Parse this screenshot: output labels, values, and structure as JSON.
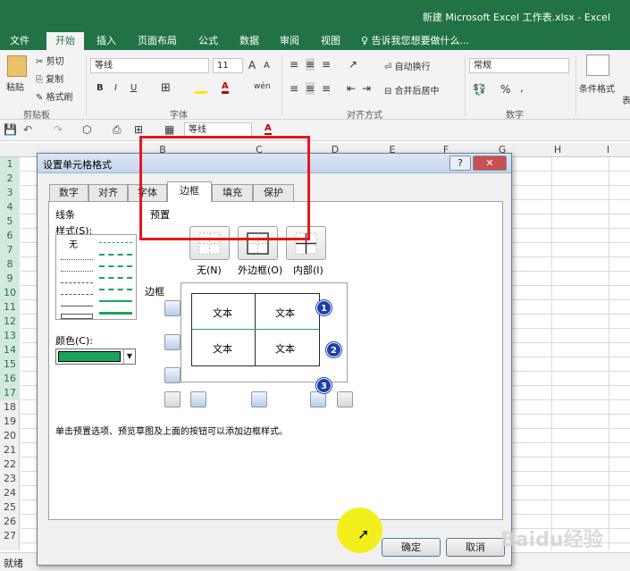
{
  "window": {
    "title": "新建 Microsoft Excel 工作表.xlsx - Excel"
  },
  "ribbon_tabs": [
    "文件",
    "开始",
    "插入",
    "页面布局",
    "公式",
    "数据",
    "审阅",
    "视图"
  ],
  "ribbon_tab_active": "开始",
  "tell_me": "告诉我您想要做什么...",
  "clipboard": {
    "paste": "粘贴",
    "cut": "剪切",
    "copy": "复制",
    "format_painter": "格式刷",
    "group": "剪贴板"
  },
  "font": {
    "name": "等线",
    "size": "11",
    "group": "字体",
    "bold": "B",
    "italic": "I",
    "underline": "U",
    "grow": "A",
    "shrink": "A",
    "font_color": "A",
    "phonetic": "wén"
  },
  "alignment": {
    "wrap": "自动换行",
    "merge": "合并后居中",
    "group": "对齐方式"
  },
  "number": {
    "format": "常规",
    "percent": "%",
    "comma": ",",
    "group": "数字"
  },
  "styles": {
    "conditional": "条件格式",
    "table_format": "表"
  },
  "qat": {
    "font_box": "等线",
    "font_color": "A"
  },
  "columns": [
    "B",
    "C",
    "D",
    "E",
    "F",
    "G",
    "H",
    "I"
  ],
  "rows": [
    "1",
    "2",
    "3",
    "4",
    "5",
    "6",
    "7",
    "8",
    "9",
    "10",
    "11",
    "12",
    "13",
    "14",
    "15",
    "16",
    "17",
    "18",
    "19",
    "20",
    "21",
    "22",
    "23",
    "24",
    "25",
    "26",
    "27"
  ],
  "status": "就绪",
  "dialog": {
    "title": "设置单元格格式",
    "help": "?",
    "close": "✕",
    "tabs": [
      "数字",
      "对齐",
      "字体",
      "边框",
      "填充",
      "保护"
    ],
    "active_tab": "边框",
    "line_label": "线条",
    "style_label": "样式(S):",
    "none_style": "无",
    "color_label": "颜色(C):",
    "color_value": "#1aa55a",
    "preset_label": "预置",
    "presets": [
      "无(N)",
      "外边框(O)",
      "内部(I)"
    ],
    "border_label": "边框",
    "preview_cells": [
      "文本",
      "文本",
      "文本",
      "文本"
    ],
    "markers": [
      "1",
      "2",
      "3"
    ],
    "hint": "单击预置选项、预览草图及上面的按钮可以添加边框样式。",
    "ok": "确定",
    "cancel": "取消"
  },
  "watermark": "Baidu经验"
}
